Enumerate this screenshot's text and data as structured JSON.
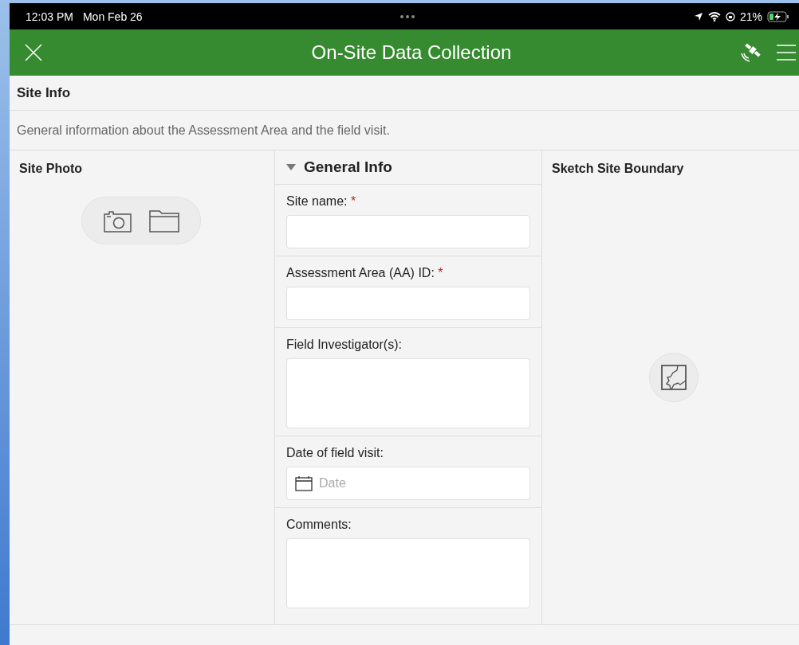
{
  "status_bar": {
    "time": "12:03 PM",
    "date": "Mon Feb 26",
    "battery": "21%"
  },
  "header": {
    "title": "On-Site Data Collection"
  },
  "section": {
    "title": "Site Info",
    "description": "General information about the Assessment Area and the field visit."
  },
  "site_photo": {
    "title": "Site Photo"
  },
  "general_info": {
    "title": "General Info",
    "expanded": true,
    "fields": [
      {
        "kind": "text",
        "label": "Site name:",
        "required_mark": "*"
      },
      {
        "kind": "text",
        "label": "Assessment Area (AA) ID:",
        "required_mark": "*"
      },
      {
        "kind": "textarea",
        "label": "Field Investigator(s):"
      },
      {
        "kind": "date",
        "label": "Date of field visit:",
        "placeholder": "Date"
      },
      {
        "kind": "textarea",
        "label": "Comments:"
      }
    ]
  },
  "sketch": {
    "title": "Sketch Site Boundary"
  }
}
